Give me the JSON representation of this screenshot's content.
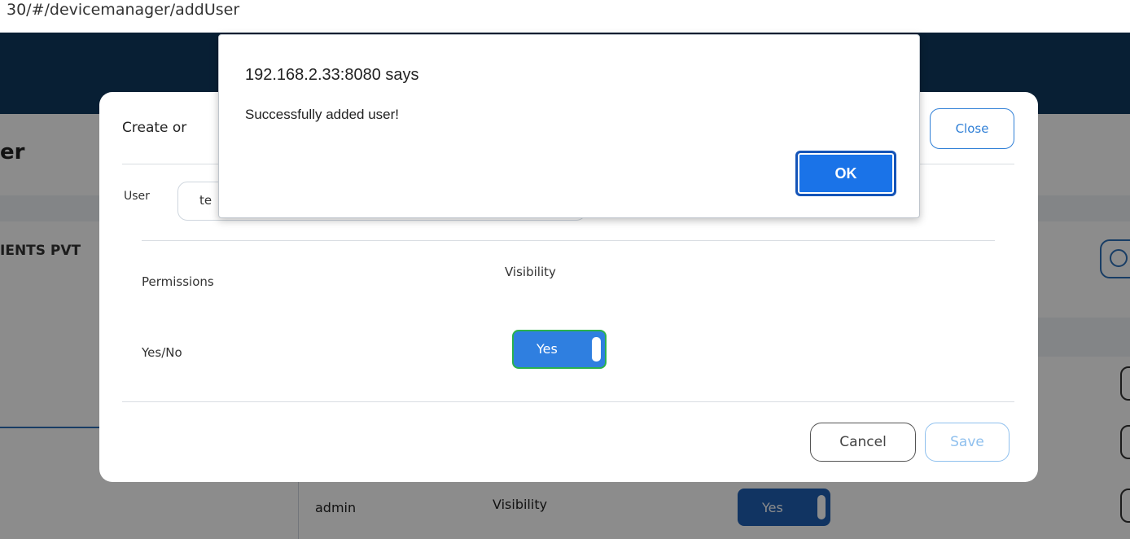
{
  "browser": {
    "url_fragment": "30/#/devicemanager/addUser"
  },
  "background": {
    "page_title_fragment": "er",
    "tab_fragment": "IENTS PVT",
    "row": {
      "user": "admin",
      "permission": "Visibility",
      "toggle_label": "Yes"
    }
  },
  "modal": {
    "title_fragment": "Create or",
    "close_label": "Close",
    "user_label": "User",
    "user_value_fragment": "te",
    "permissions_header": "Permissions",
    "visibility_header": "Visibility",
    "yesno_label": "Yes/No",
    "toggle_label": "Yes",
    "toggle_state": "on",
    "cancel_label": "Cancel",
    "save_label": "Save"
  },
  "alert": {
    "title": "192.168.2.33:8080 says",
    "message": "Successfully added user!",
    "ok_label": "OK"
  },
  "colors": {
    "header_band": "#0f3a5f",
    "accent": "#2f7fe0",
    "toggle_border": "#2bb24c",
    "ok_button": "#1a73e8"
  }
}
